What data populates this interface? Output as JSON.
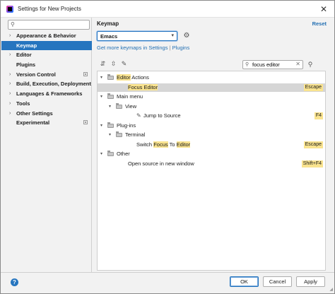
{
  "window": {
    "title": "Settings for New Projects",
    "close_label": "✕"
  },
  "sidebar": {
    "search_placeholder": "",
    "items": [
      {
        "label": "Appearance & Behavior",
        "expandable": true,
        "selected": false,
        "project_badge": false
      },
      {
        "label": "Keymap",
        "expandable": false,
        "selected": true,
        "project_badge": false
      },
      {
        "label": "Editor",
        "expandable": true,
        "selected": false,
        "project_badge": false
      },
      {
        "label": "Plugins",
        "expandable": false,
        "selected": false,
        "project_badge": false
      },
      {
        "label": "Version Control",
        "expandable": true,
        "selected": false,
        "project_badge": true
      },
      {
        "label": "Build, Execution, Deployment",
        "expandable": true,
        "selected": false,
        "project_badge": false
      },
      {
        "label": "Languages & Frameworks",
        "expandable": true,
        "selected": false,
        "project_badge": false
      },
      {
        "label": "Tools",
        "expandable": true,
        "selected": false,
        "project_badge": false
      },
      {
        "label": "Other Settings",
        "expandable": true,
        "selected": false,
        "project_badge": false
      },
      {
        "label": "Experimental",
        "expandable": false,
        "selected": false,
        "project_badge": true
      }
    ]
  },
  "main": {
    "heading": "Keymap",
    "reset_label": "Reset",
    "keymap_value": "Emacs",
    "links": {
      "more": "Get more keymaps in Settings",
      "separator": "|",
      "plugins": "Plugins"
    },
    "filter_value": "focus editor",
    "tree": [
      {
        "depth": 0,
        "type": "folder",
        "expanded": true,
        "parts": [
          {
            "t": "Editor",
            "h": true
          },
          {
            "t": " Actions",
            "h": false
          }
        ],
        "shortcut": ""
      },
      {
        "depth": 1,
        "type": "action",
        "selected": true,
        "parts": [
          {
            "t": "Focus Editor",
            "h": true
          }
        ],
        "shortcut": "Escape"
      },
      {
        "depth": 0,
        "type": "folder",
        "expanded": true,
        "parts": [
          {
            "t": "Main menu",
            "h": false
          }
        ],
        "shortcut": ""
      },
      {
        "depth": 1,
        "type": "folder",
        "expanded": true,
        "parts": [
          {
            "t": "View",
            "h": false
          }
        ],
        "shortcut": ""
      },
      {
        "depth": 2,
        "type": "action",
        "icon": "pencil",
        "parts": [
          {
            "t": "Jump to Source",
            "h": false
          }
        ],
        "shortcut": "F4"
      },
      {
        "depth": 0,
        "type": "folder",
        "expanded": true,
        "parts": [
          {
            "t": "Plug-ins",
            "h": false
          }
        ],
        "shortcut": ""
      },
      {
        "depth": 1,
        "type": "folder",
        "expanded": true,
        "parts": [
          {
            "t": "Terminal",
            "h": false
          }
        ],
        "shortcut": ""
      },
      {
        "depth": 2,
        "type": "action",
        "parts": [
          {
            "t": "Switch ",
            "h": false
          },
          {
            "t": "Focus",
            "h": true
          },
          {
            "t": " To ",
            "h": false
          },
          {
            "t": "Editor",
            "h": true
          }
        ],
        "shortcut": "Escape"
      },
      {
        "depth": 0,
        "type": "folder",
        "expanded": true,
        "parts": [
          {
            "t": "Other",
            "h": false
          }
        ],
        "shortcut": ""
      },
      {
        "depth": 1,
        "type": "action",
        "parts": [
          {
            "t": "Open source in new window",
            "h": false
          }
        ],
        "shortcut": "Shift+F4"
      }
    ]
  },
  "footer": {
    "help_label": "?",
    "ok_label": "OK",
    "cancel_label": "Cancel",
    "apply_label": "Apply"
  },
  "icons": {
    "app": "intellij-logo-icon",
    "search": "search-icon",
    "gear": "gear-icon",
    "expand_all": "expand-all-icon",
    "collapse_all": "collapse-all-icon",
    "edit": "pencil-icon",
    "find_shortcut": "find-by-shortcut-icon",
    "clear": "clear-icon",
    "help": "help-icon"
  },
  "colors": {
    "accent": "#2675bf",
    "link": "#2470b3",
    "highlight": "#f9e38f",
    "selected_row": "#d6d6d6"
  }
}
